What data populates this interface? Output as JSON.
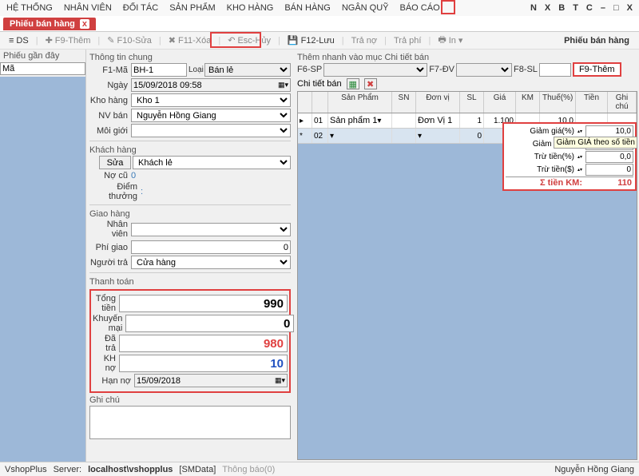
{
  "menu": [
    "HỆ THỐNG",
    "NHÂN VIÊN",
    "ĐỐI TÁC",
    "SẢN PHẨM",
    "KHO HÀNG",
    "BÁN HÀNG",
    "NGÂN QUỸ",
    "BÁO CÁO"
  ],
  "mini": {
    "n": "N",
    "x": "X",
    "b": "B",
    "t": "T",
    "c": "C",
    "min": "–",
    "max": "□",
    "close": "X"
  },
  "tab": {
    "title": "Phiếu bán hàng",
    "close": "x"
  },
  "toolbar": {
    "ds": "DS",
    "f9": "F9-Thêm",
    "f10": "F10-Sửa",
    "f11": "F11-Xóa",
    "esc": "Esc-Hủy",
    "f12": "F12-Lưu",
    "trano": "Trả nợ",
    "traphi": "Trả phí",
    "in": "In",
    "title": "Phiếu bán hàng"
  },
  "left": {
    "title": "Phiếu gần đây",
    "search": "Mã"
  },
  "general": {
    "title": "Thông tin chung",
    "f1": "F1-Mã",
    "f1v": "BH-1",
    "loai": "Loại",
    "loaiv": "Bán lẻ",
    "ngay": "Ngày",
    "ngayv": "15/09/2018 09:58",
    "kho": "Kho hàng",
    "khov": "Kho 1",
    "nv": "NV bán",
    "nvv": "Nguyễn Hồng Giang",
    "mg": "Môi giới",
    "mgv": ""
  },
  "customer": {
    "title": "Khách hàng",
    "sua": "Sửa",
    "name": "Khách lẻ",
    "nocu": "Nợ cũ",
    "nocuv": "0"
  },
  "diemthuong": {
    "lbl": "Điểm thưởng",
    "v": ":"
  },
  "delivery": {
    "title": "Giao hàng",
    "nv": "Nhân viên",
    "phi": "Phí giao",
    "phiv": "0",
    "ng": "Người trả",
    "ngv": "Cửa hàng"
  },
  "payment": {
    "title": "Thanh toán",
    "tong": "Tổng tiền",
    "tongv": "990",
    "km": "Khuyến mại",
    "kmv": "0",
    "datra": "Đã trả",
    "datrav": "980",
    "khno": "KH nợ",
    "khnov": "10",
    "hanno": "Hạn nợ",
    "hannov": "15/09/2018"
  },
  "ghichu": "Ghi chú",
  "quick": {
    "title": "Thêm nhanh vào mục Chi tiết bán",
    "f6": "F6-SP",
    "f7": "F7-ĐV",
    "f8": "F8-SL",
    "f9": "F9-Thêm"
  },
  "detail": {
    "title": "Chi tiết bán"
  },
  "gridh": {
    "sp": "Sản Phẩm",
    "sn": "SN",
    "dv": "Đơn vị",
    "sl": "SL",
    "gia": "Giá",
    "km": "KM",
    "thue": "Thuế(%)",
    "tien": "Tiền",
    "ghi": "Ghi chú"
  },
  "row1": {
    "idx": "01",
    "sp": "Sản phẩm 1",
    "dv": "Đơn Vị 1",
    "sl": "1",
    "gia": "1.100",
    "km": "",
    "thue": "10,0"
  },
  "row2": {
    "idx": "02",
    "sl": "0",
    "gia": "0"
  },
  "kmpanel": {
    "gg": "Giảm giá(%)",
    "ggv": "10,0",
    "ggd": "Giảm giá($)",
    "ggdv": "0",
    "tt": "Trừ tiền(%)",
    "ttv": "0,0",
    "ttd": "Trừ tiền($)",
    "ttdv": "0",
    "sum": "Σ tiền KM:",
    "sumv": "110",
    "tooltip": "Giảm GIÁ theo số tiền"
  },
  "status": {
    "app": "VshopPlus",
    "srv": "Server:",
    "srvv": "localhost\\vshopplus",
    "db": "[SMData]",
    "tb": "Thông báo(0)",
    "user": "Nguyễn Hồng Giang"
  }
}
